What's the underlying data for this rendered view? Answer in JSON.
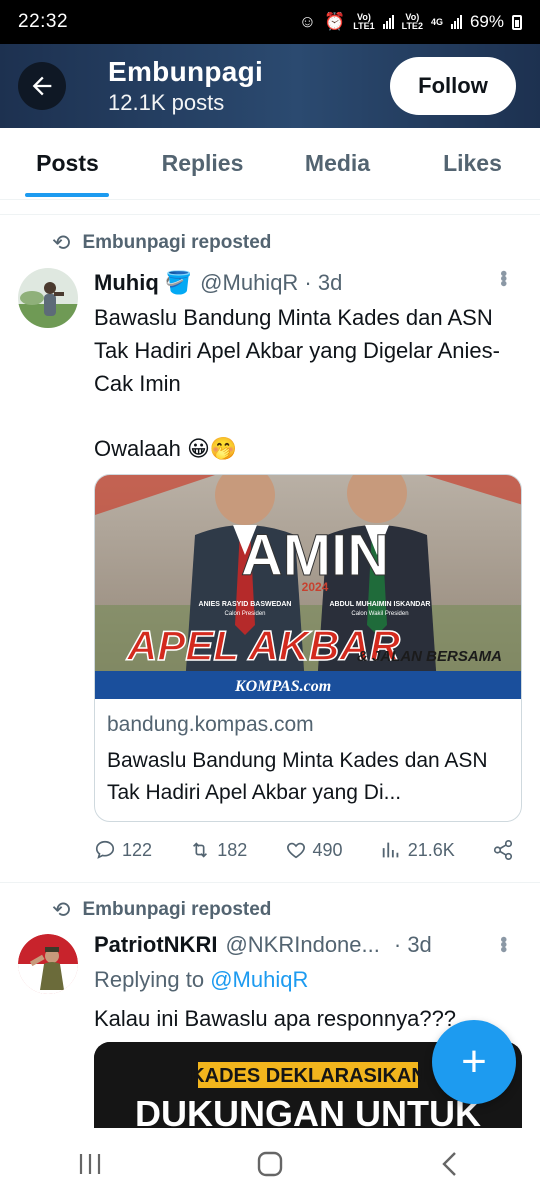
{
  "status_bar": {
    "time": "22:32",
    "sim1": "Vo)\nLTE1",
    "sim2": "Vo)\nLTE2",
    "net": "4G",
    "battery": "69%"
  },
  "header": {
    "title": "Embunpagi",
    "subtitle": "12.1K posts",
    "follow_label": "Follow"
  },
  "tabs": [
    {
      "label": "Posts",
      "active": true
    },
    {
      "label": "Replies",
      "active": false
    },
    {
      "label": "Media",
      "active": false
    },
    {
      "label": "Likes",
      "active": false
    }
  ],
  "posts": [
    {
      "repost_label": "Embunpagi reposted",
      "name": "Muhiq",
      "handle": "@MuhiqR · 3d",
      "text": "Bawaslu Bandung Minta Kades dan ASN Tak Hadiri Apel Akbar yang Digelar Anies-Cak Imin",
      "text2": "Owalaah 😀🤭",
      "card": {
        "domain": "bandung.kompas.com",
        "title": "Bawaslu Bandung Minta Kades dan ASN Tak Hadiri Apel Akbar yang Di...",
        "image_text": {
          "headline": "AMIN",
          "year": "2024",
          "left_name": "ANIES RASYID BASWEDAN",
          "left_role": "Calon Presiden",
          "right_name": "ABDUL MUHAIMIN ISKANDAR",
          "right_role": "Calon Wakil Presiden",
          "event": "APEL AKBAR",
          "event2": "& JALAN BERSAMA",
          "brand": "KOMPAS.com"
        }
      },
      "stats": {
        "replies": "122",
        "reposts": "182",
        "likes": "490",
        "views": "21.6K"
      }
    },
    {
      "repost_label": "Embunpagi reposted",
      "name": "PatriotNKRI",
      "handle": "@NKRIndone...",
      "time": "· 3d",
      "reply_prefix": "Replying to",
      "reply_mention": "@MuhiqR",
      "text": "Kalau ini Bawaslu apa responnya???",
      "image_text": {
        "line1": "KADES DEKLARASIKAN",
        "line2": "DUKUNGAN UNTUK"
      }
    }
  ],
  "colors": {
    "accent": "#1d9bf0",
    "header_bg": "#2b4a70",
    "muted": "#536471"
  }
}
